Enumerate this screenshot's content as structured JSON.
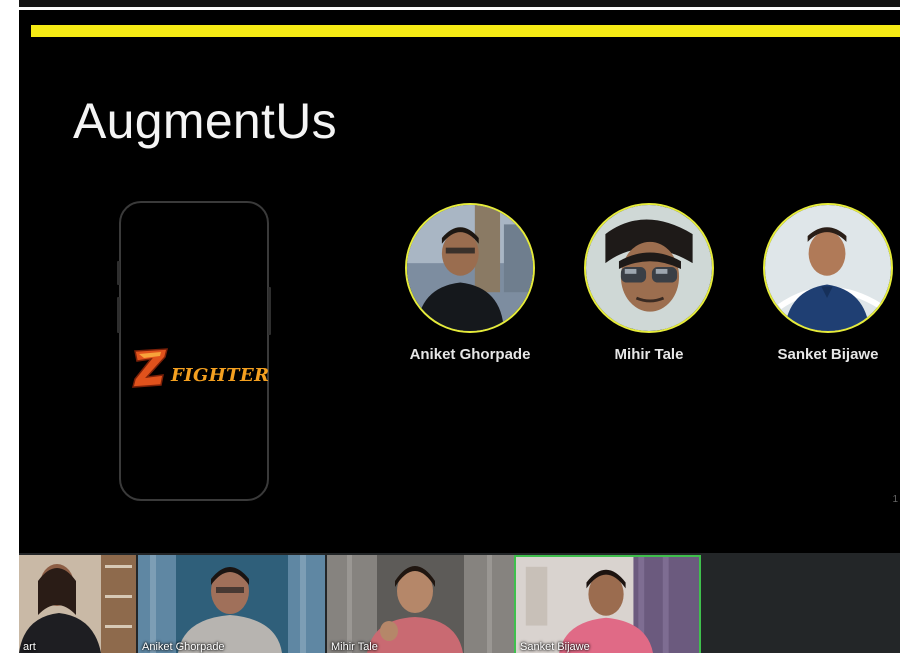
{
  "colors": {
    "slide_background": "#000000",
    "accent_bar": "#f5ea14",
    "avatar_ring": "#e6ec3a",
    "active_speaker_border": "#3fbf4d",
    "logo_z": "#e0521c",
    "logo_text": "#f4a020"
  },
  "slide": {
    "title": "AugmentUs",
    "phone_mockup": {
      "logo_icon": "z-letter-icon",
      "logo_text": "FIGHTER"
    },
    "team": [
      {
        "name": "Aniket Ghorpade",
        "avatar": "person-photo"
      },
      {
        "name": "Mihir Tale",
        "avatar": "person-photo"
      },
      {
        "name": "Sanket Bijawe",
        "avatar": "person-photo"
      }
    ],
    "page_number": "1"
  },
  "participants": [
    {
      "name": "art",
      "active": false
    },
    {
      "name": "Aniket Ghorpade",
      "active": false
    },
    {
      "name": "Mihir Tale",
      "active": false
    },
    {
      "name": "Sanket Bijawe",
      "active": true
    }
  ]
}
